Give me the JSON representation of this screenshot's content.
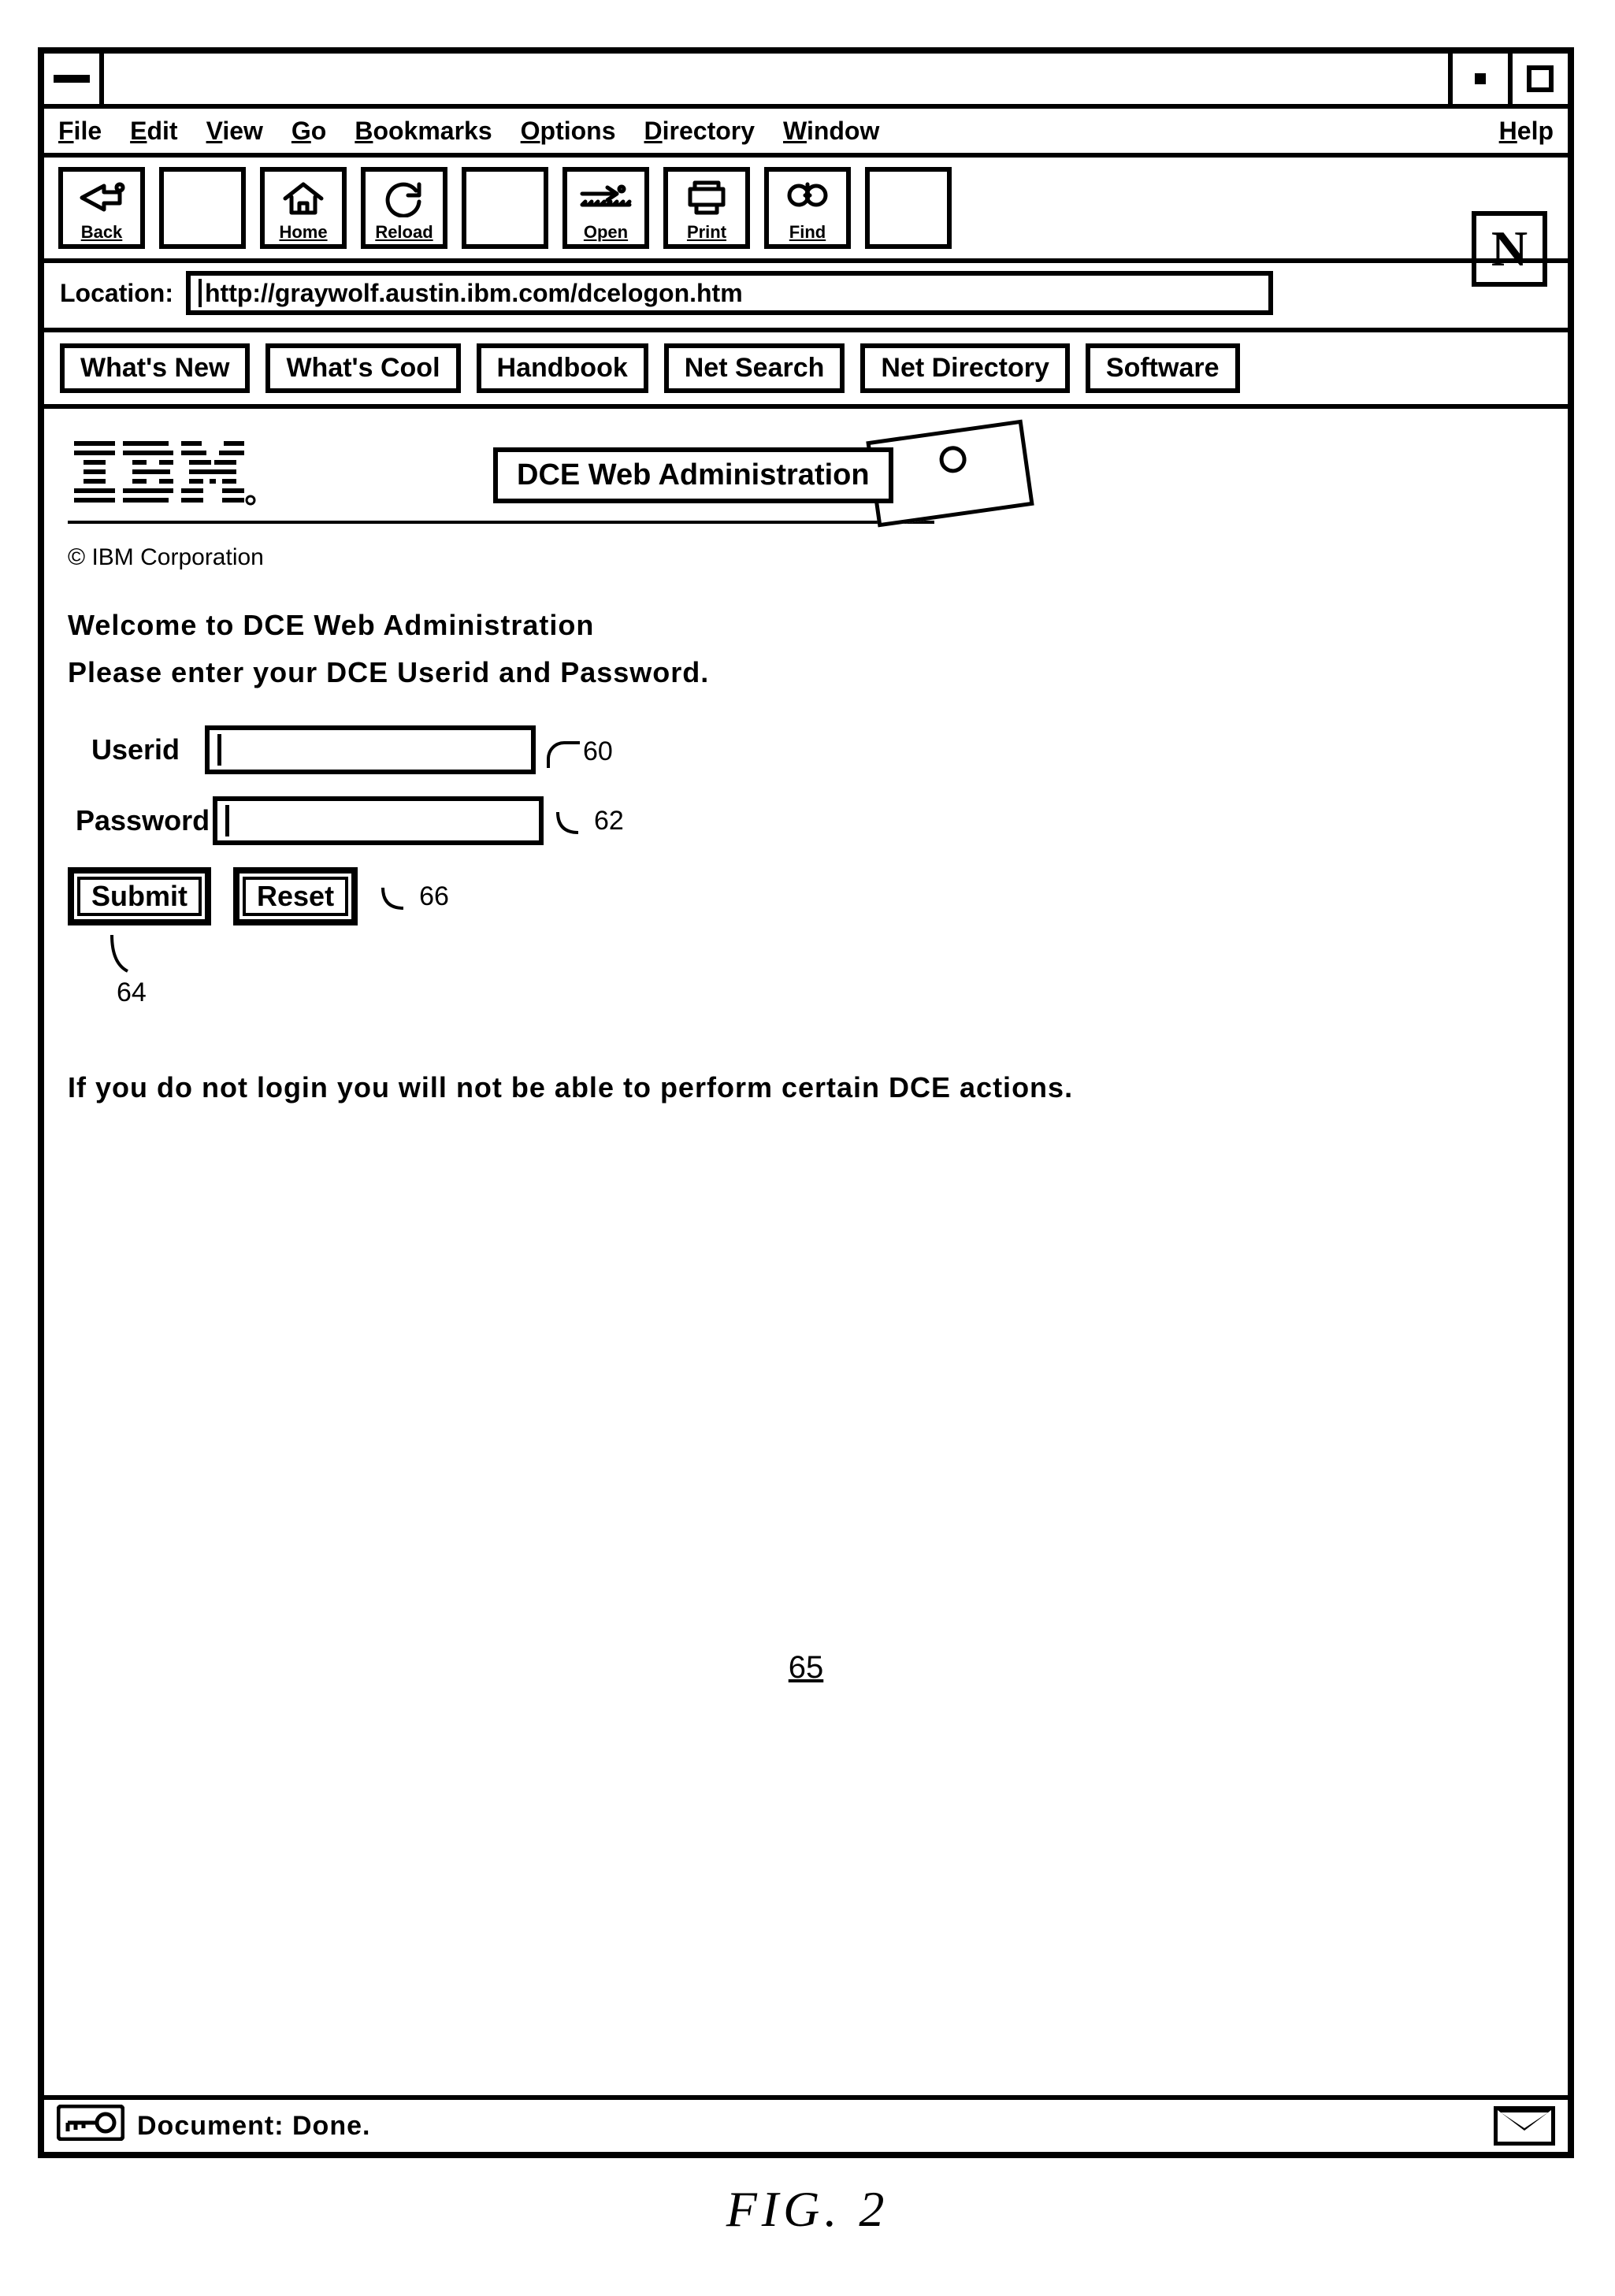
{
  "menu": {
    "file": "File",
    "edit": "Edit",
    "view": "View",
    "go": "Go",
    "bookmarks": "Bookmarks",
    "options": "Options",
    "directory": "Directory",
    "window": "Window",
    "help": "Help"
  },
  "toolbar": {
    "back": "Back",
    "home": "Home",
    "reload": "Reload",
    "open": "Open",
    "print": "Print",
    "find": "Find"
  },
  "location": {
    "label": "Location:",
    "url": "http://graywolf.austin.ibm.com/dcelogon.htm"
  },
  "quicklinks": {
    "whatsnew": "What's New",
    "whatscool": "What's Cool",
    "handbook": "Handbook",
    "netsearch": "Net Search",
    "netdirectory": "Net Directory",
    "software": "Software"
  },
  "logo_n": "N",
  "page": {
    "ibm": "IBM.",
    "banner": "DCE Web Administration",
    "copyright": "© IBM Corporation",
    "welcome": "Welcome to DCE Web Administration",
    "prompt": "Please enter your DCE Userid and Password.",
    "userid_label": "Userid",
    "password_label": "Password",
    "submit": "Submit",
    "reset": "Reset",
    "note": "If you do not login you will not be able to perform certain DCE actions.",
    "callout_userid": "60",
    "callout_password": "62",
    "callout_submit": "64",
    "callout_reset": "66",
    "page_number": "65"
  },
  "status": {
    "text": "Document: Done."
  },
  "figure": "FIG. 2"
}
